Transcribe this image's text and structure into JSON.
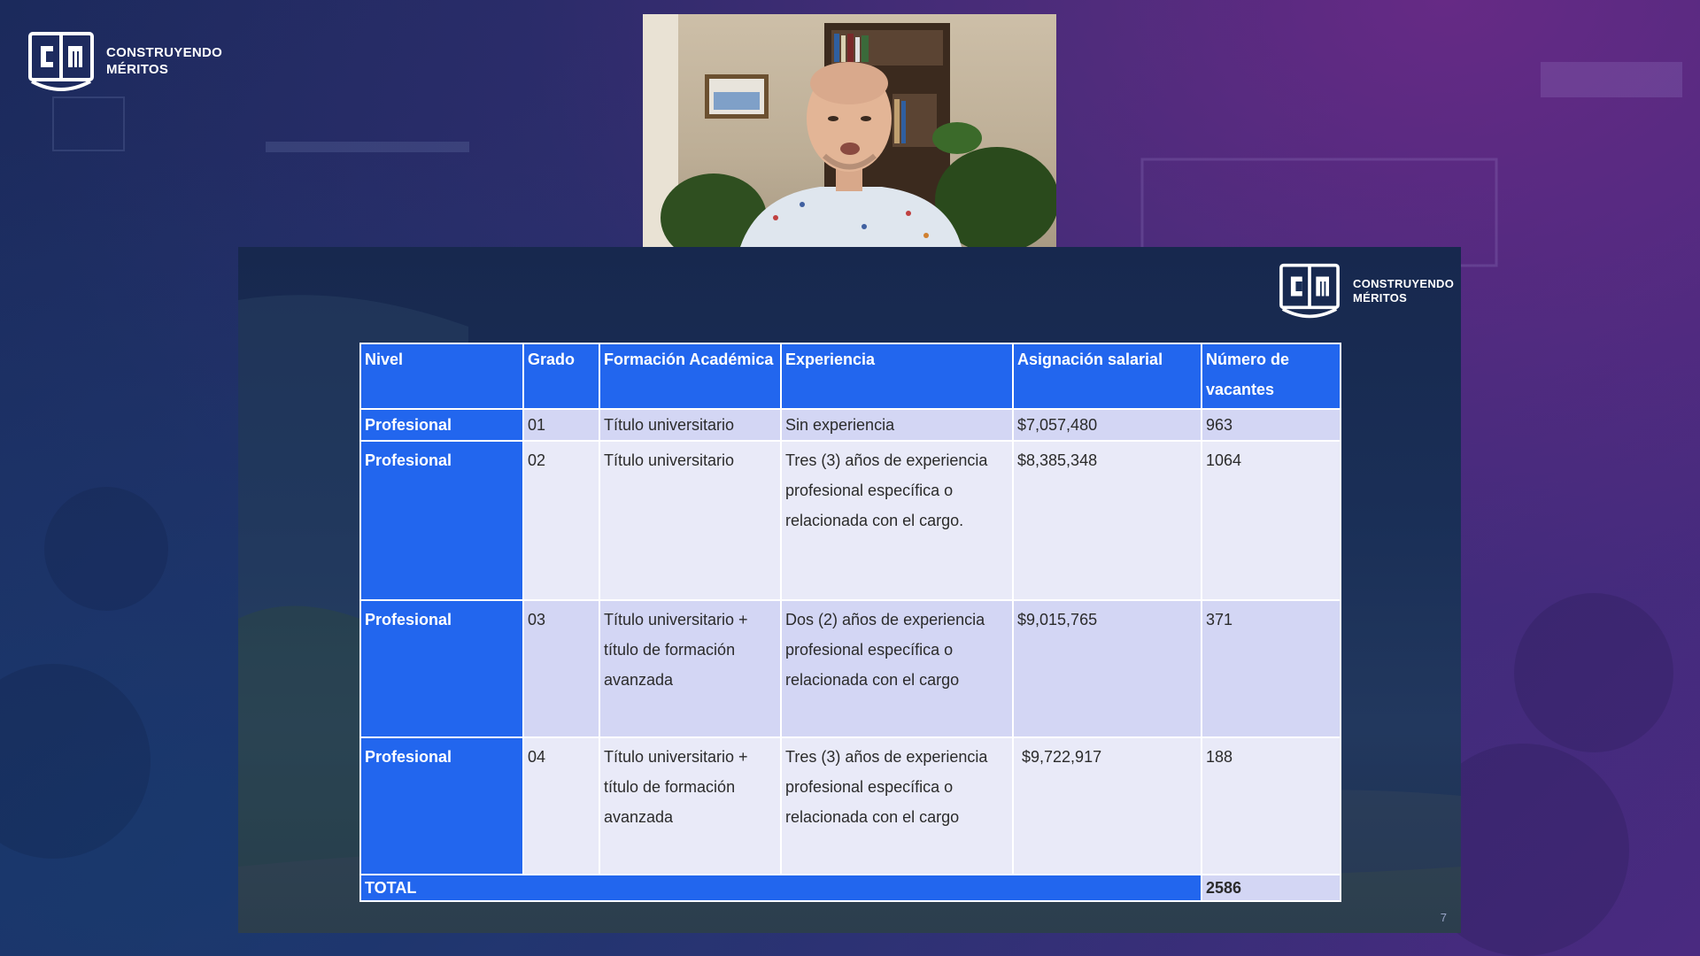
{
  "brand": {
    "line1": "CONSTRUYENDO",
    "line2": "MÉRITOS"
  },
  "colors": {
    "header_blue": "#2266ee",
    "row_light": "#e9eaf8",
    "row_mid": "#d3d6f4",
    "background": "#26306a"
  },
  "webcam": {
    "icon": "presenter-video-icon"
  },
  "table": {
    "headers": {
      "nivel": "Nivel",
      "grado": "Grado",
      "formacion": "Formación Académica",
      "experiencia": "Experiencia",
      "asignacion": "Asignación salarial",
      "vacantes": "Número de vacantes"
    },
    "rows": [
      {
        "nivel": "Profesional",
        "grado": "01",
        "formacion": "Título universitario",
        "experiencia": "Sin experiencia",
        "asignacion": "$7,057,480",
        "vacantes": "963"
      },
      {
        "nivel": "Profesional",
        "grado": "02",
        "formacion": "Título universitario",
        "experiencia": "Tres (3) años de experiencia profesional específica o relacionada con el cargo.",
        "asignacion": "$8,385,348",
        "vacantes": "1064"
      },
      {
        "nivel": "Profesional",
        "grado": "03",
        "formacion": "Título universitario + título de formación avanzada",
        "experiencia": "Dos (2) años de experiencia profesional específica o relacionada con el cargo",
        "asignacion": "$9,015,765",
        "vacantes": "371"
      },
      {
        "nivel": "Profesional",
        "grado": "04",
        "formacion": "Título universitario + título de formación avanzada",
        "experiencia": "Tres (3) años de experiencia profesional específica o relacionada con el cargo",
        "asignacion": "$9,722,917",
        "vacantes": "188"
      }
    ],
    "total": {
      "label": "TOTAL",
      "value": "2586"
    }
  },
  "page_number": "7"
}
